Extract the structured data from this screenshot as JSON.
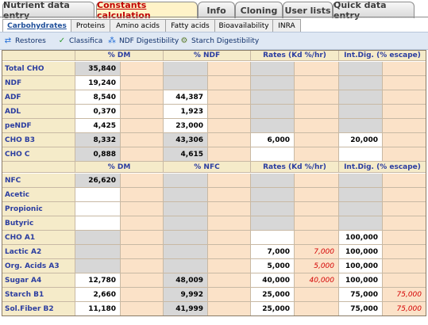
{
  "top_tabs": [
    {
      "label": "Nutrient data entry",
      "active": false
    },
    {
      "label": "Constants calculation",
      "active": true
    },
    {
      "label": "Info",
      "active": false
    },
    {
      "label": "Cloning",
      "active": false
    },
    {
      "label": "User lists",
      "active": false
    },
    {
      "label": "Quick data entry",
      "active": false
    }
  ],
  "sub_tabs": [
    {
      "label": "Carbohydrates",
      "active": true
    },
    {
      "label": "Proteins",
      "active": false
    },
    {
      "label": "Amino acids",
      "active": false
    },
    {
      "label": "Fatty acids",
      "active": false
    },
    {
      "label": "Bioavailability",
      "active": false
    },
    {
      "label": "INRA",
      "active": false
    }
  ],
  "toolbar": [
    {
      "label": "Restores",
      "icon": "restore-arrows-icon"
    },
    {
      "label": "Classifica",
      "icon": "checkmark-icon"
    },
    {
      "label": "NDF Digestibility",
      "icon": "scatter-icon"
    },
    {
      "label": "Starch Digestibility",
      "icon": "gears-icon"
    }
  ],
  "header1": [
    "% DM",
    "% NDF",
    "Rates (Kd %/hr)",
    "Int.Dig. (% escape)"
  ],
  "header2": [
    "% DM",
    "% NFC",
    "Rates (Kd %/hr)",
    "Int.Dig. (% escape)"
  ],
  "section1": [
    {
      "label": "Total CHO",
      "c": [
        "35,840",
        "",
        "",
        "",
        "",
        "",
        "",
        ""
      ],
      "t": [
        "g",
        "p",
        "g",
        "p",
        "g",
        "p",
        "g",
        "p"
      ]
    },
    {
      "label": "NDF",
      "c": [
        "19,240",
        "",
        "",
        "",
        "",
        "",
        "",
        ""
      ],
      "t": [
        "w",
        "p",
        "g",
        "p",
        "g",
        "p",
        "g",
        "p"
      ]
    },
    {
      "label": "ADF",
      "c": [
        "8,540",
        "",
        "44,387",
        "",
        "",
        "",
        "",
        ""
      ],
      "t": [
        "w",
        "p",
        "w",
        "p",
        "g",
        "p",
        "g",
        "p"
      ]
    },
    {
      "label": "ADL",
      "c": [
        "0,370",
        "",
        "1,923",
        "",
        "",
        "",
        "",
        ""
      ],
      "t": [
        "w",
        "p",
        "w",
        "p",
        "g",
        "p",
        "g",
        "p"
      ]
    },
    {
      "label": "peNDF",
      "c": [
        "4,425",
        "",
        "23,000",
        "",
        "",
        "",
        "",
        ""
      ],
      "t": [
        "w",
        "p",
        "w",
        "p",
        "g",
        "p",
        "g",
        "p"
      ]
    },
    {
      "label": "CHO  B3",
      "c": [
        "8,332",
        "",
        "43,306",
        "",
        "6,000",
        "",
        "20,000",
        ""
      ],
      "t": [
        "g",
        "p",
        "g",
        "p",
        "w",
        "p",
        "w",
        "p"
      ]
    },
    {
      "label": "CHO  C",
      "c": [
        "0,888",
        "",
        "4,615",
        "",
        "",
        "",
        "",
        ""
      ],
      "t": [
        "g",
        "p",
        "g",
        "p",
        "w",
        "p",
        "w",
        "p"
      ]
    }
  ],
  "section2": [
    {
      "label": "NFC",
      "c": [
        "26,620",
        "",
        "",
        "",
        "",
        "",
        "",
        ""
      ],
      "t": [
        "g",
        "p",
        "g",
        "p",
        "g",
        "p",
        "g",
        "p"
      ]
    },
    {
      "label": "Acetic",
      "c": [
        "",
        "",
        "",
        "",
        "",
        "",
        "",
        ""
      ],
      "t": [
        "w",
        "p",
        "g",
        "p",
        "g",
        "p",
        "g",
        "p"
      ]
    },
    {
      "label": "Propionic",
      "c": [
        "",
        "",
        "",
        "",
        "",
        "",
        "",
        ""
      ],
      "t": [
        "w",
        "p",
        "g",
        "p",
        "g",
        "p",
        "g",
        "p"
      ]
    },
    {
      "label": "Butyric",
      "c": [
        "",
        "",
        "",
        "",
        "",
        "",
        "",
        ""
      ],
      "t": [
        "w",
        "p",
        "g",
        "p",
        "g",
        "p",
        "g",
        "p"
      ]
    },
    {
      "label": "CHO A1",
      "c": [
        "",
        "",
        "",
        "",
        "",
        "",
        "100,000",
        ""
      ],
      "t": [
        "g",
        "p",
        "g",
        "p",
        "w",
        "p",
        "w",
        "p"
      ]
    },
    {
      "label": "Lactic  A2",
      "c": [
        "",
        "",
        "",
        "",
        "7,000",
        "7,000",
        "100,000",
        ""
      ],
      "t": [
        "g",
        "p",
        "g",
        "p",
        "w",
        "pr",
        "w",
        "p"
      ]
    },
    {
      "label": "Org. Acids A3",
      "c": [
        "",
        "",
        "",
        "",
        "5,000",
        "5,000",
        "100,000",
        ""
      ],
      "t": [
        "g",
        "p",
        "g",
        "p",
        "w",
        "pr",
        "w",
        "p"
      ]
    },
    {
      "label": "Sugar    A4",
      "c": [
        "12,780",
        "",
        "48,009",
        "",
        "40,000",
        "40,000",
        "100,000",
        ""
      ],
      "t": [
        "w",
        "p",
        "g",
        "p",
        "w",
        "pr",
        "w",
        "p"
      ]
    },
    {
      "label": "Starch   B1",
      "c": [
        "2,660",
        "",
        "9,992",
        "",
        "25,000",
        "",
        "75,000",
        "75,000"
      ],
      "t": [
        "w",
        "p",
        "g",
        "p",
        "w",
        "p",
        "w",
        "pr"
      ]
    },
    {
      "label": "Sol.Fiber B2",
      "c": [
        "11,180",
        "",
        "41,999",
        "",
        "25,000",
        "",
        "75,000",
        "75,000"
      ],
      "t": [
        "w",
        "p",
        "g",
        "p",
        "w",
        "p",
        "w",
        "pr"
      ]
    }
  ]
}
